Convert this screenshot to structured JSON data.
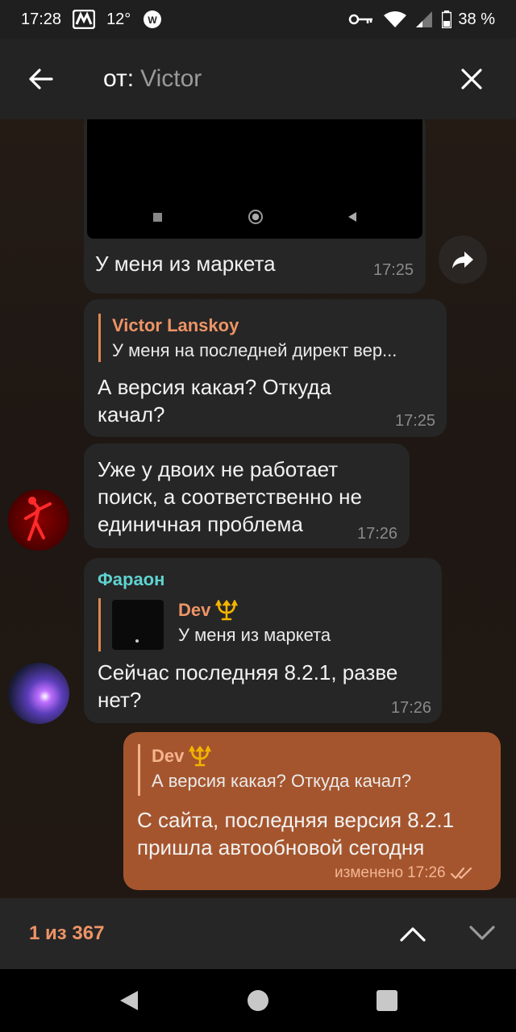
{
  "status_bar": {
    "time": "17:28",
    "temperature": "12°",
    "battery": "38 %",
    "icons": [
      "app-m-icon",
      "weather-icon",
      "key-icon",
      "wifi-icon",
      "signal-icon",
      "battery-icon"
    ]
  },
  "search": {
    "label": "от:",
    "value": "Victor"
  },
  "messages": [
    {
      "caption": "У меня из маркета",
      "time": "17:25"
    },
    {
      "reply_name": "Victor Lanskoy",
      "reply_text": "У меня на последней директ вер...",
      "line1": "А версия какая? Откуда",
      "line2": "качал?",
      "time": "17:25"
    },
    {
      "line1": "Уже у двоих не работает",
      "line2": "поиск, а соответственно не",
      "line3": "единичная проблема",
      "time": "17:26"
    },
    {
      "sender": "Фараон",
      "reply_name": "Dev",
      "reply_text": "У меня из маркета",
      "line1": "Сейчас последняя 8.2.1, разве",
      "line2": "нет?",
      "time": "17:26"
    },
    {
      "reply_name": "Dev",
      "reply_text": "А версия какая? Откуда качал?",
      "line1": "С сайта, последняя версия 8.2.1",
      "line2": "пришла автообновой сегодня",
      "edited": "изменено",
      "time": "17:26"
    }
  ],
  "bottom": {
    "counter": "1 из 367"
  },
  "colors": {
    "accent": "#ee9466",
    "outgoing_bubble": "#a5552d",
    "incoming_bubble": "#262626",
    "sender_name": "#5fd3d0"
  }
}
